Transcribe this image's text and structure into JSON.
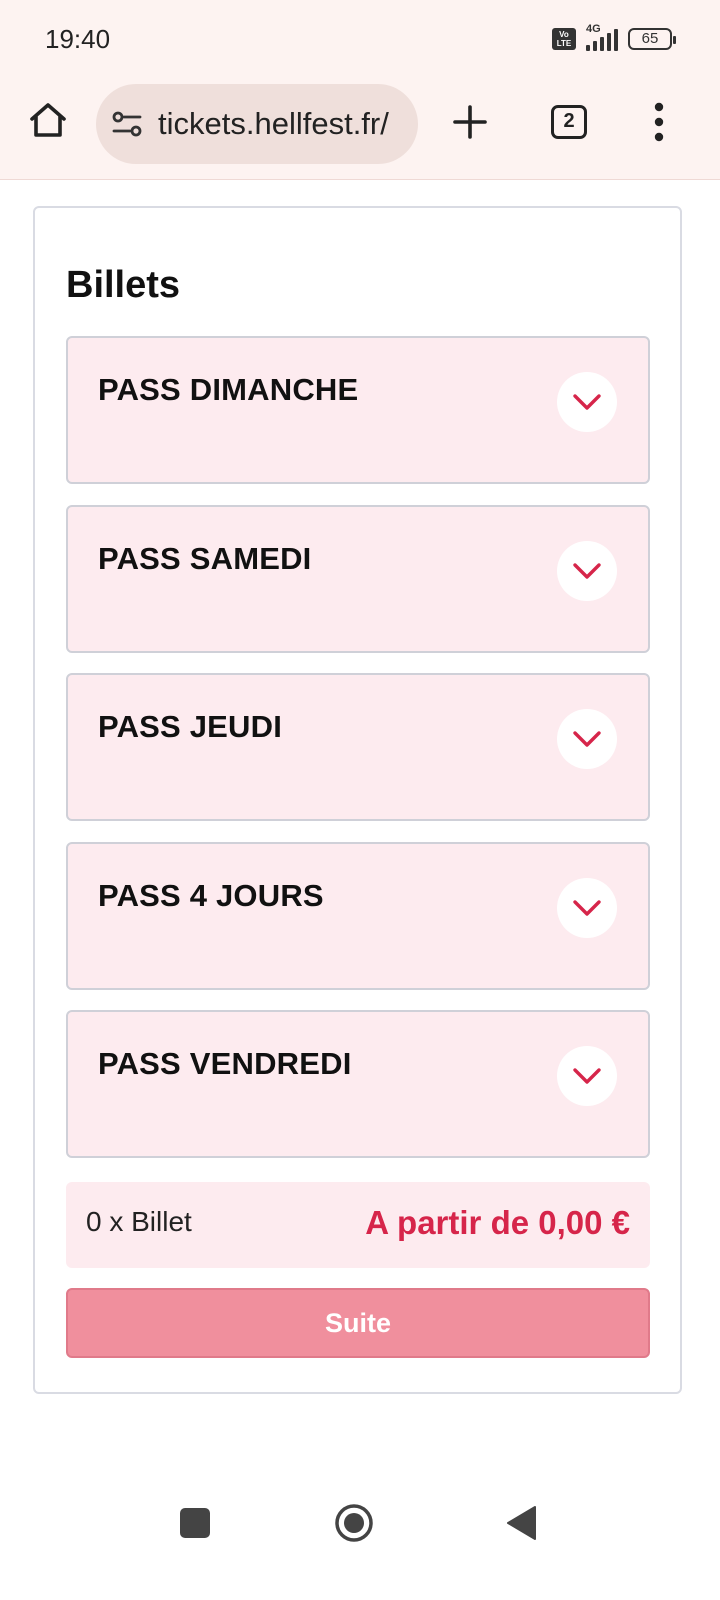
{
  "status_bar": {
    "time": "19:40",
    "network": "4G",
    "volte": "Vo LTE",
    "battery": "65"
  },
  "browser": {
    "url": "tickets.hellfest.fr/",
    "tab_count": "2",
    "icons": [
      "home-icon",
      "site-settings-icon",
      "plus-icon",
      "tabs-icon",
      "more-vert-icon"
    ]
  },
  "tickets": {
    "title": "Billets",
    "passes": [
      {
        "name": "PASS DIMANCHE"
      },
      {
        "name": "PASS SAMEDI"
      },
      {
        "name": "PASS JEUDI"
      },
      {
        "name": "PASS 4 JOURS"
      },
      {
        "name": "PASS VENDREDI"
      }
    ],
    "summary": {
      "quantity": "0 x Billet",
      "price": "A partir de 0,00 €"
    },
    "next_button": "Suite"
  },
  "colors": {
    "accent": "#d6254a",
    "pass_bg": "#fdebef",
    "button_disabled": "#f08f9d",
    "chrome_bg": "#fdf3f1"
  }
}
